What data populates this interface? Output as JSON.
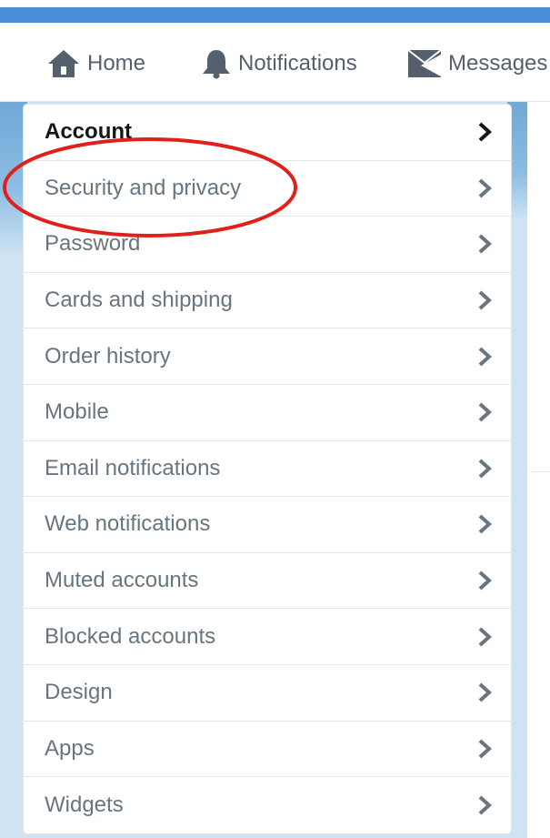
{
  "colors": {
    "top_bar": "#4a90d9",
    "nav_text": "#55606e",
    "menu_text": "#66757f",
    "active_text": "#14171a",
    "highlight": "#e0201a",
    "backdrop": "#cfe3f3"
  },
  "nav": {
    "items": [
      {
        "label": "Home",
        "icon": "home-icon"
      },
      {
        "label": "Notifications",
        "icon": "bell-icon"
      },
      {
        "label": "Messages",
        "icon": "envelope-icon"
      }
    ]
  },
  "menu": {
    "active_index": 0,
    "highlighted_index": 1,
    "items": [
      {
        "label": "Account"
      },
      {
        "label": "Security and privacy"
      },
      {
        "label": "Password"
      },
      {
        "label": "Cards and shipping"
      },
      {
        "label": "Order history"
      },
      {
        "label": "Mobile"
      },
      {
        "label": "Email notifications"
      },
      {
        "label": "Web notifications"
      },
      {
        "label": "Muted accounts"
      },
      {
        "label": "Blocked accounts"
      },
      {
        "label": "Design"
      },
      {
        "label": "Apps"
      },
      {
        "label": "Widgets"
      }
    ]
  }
}
